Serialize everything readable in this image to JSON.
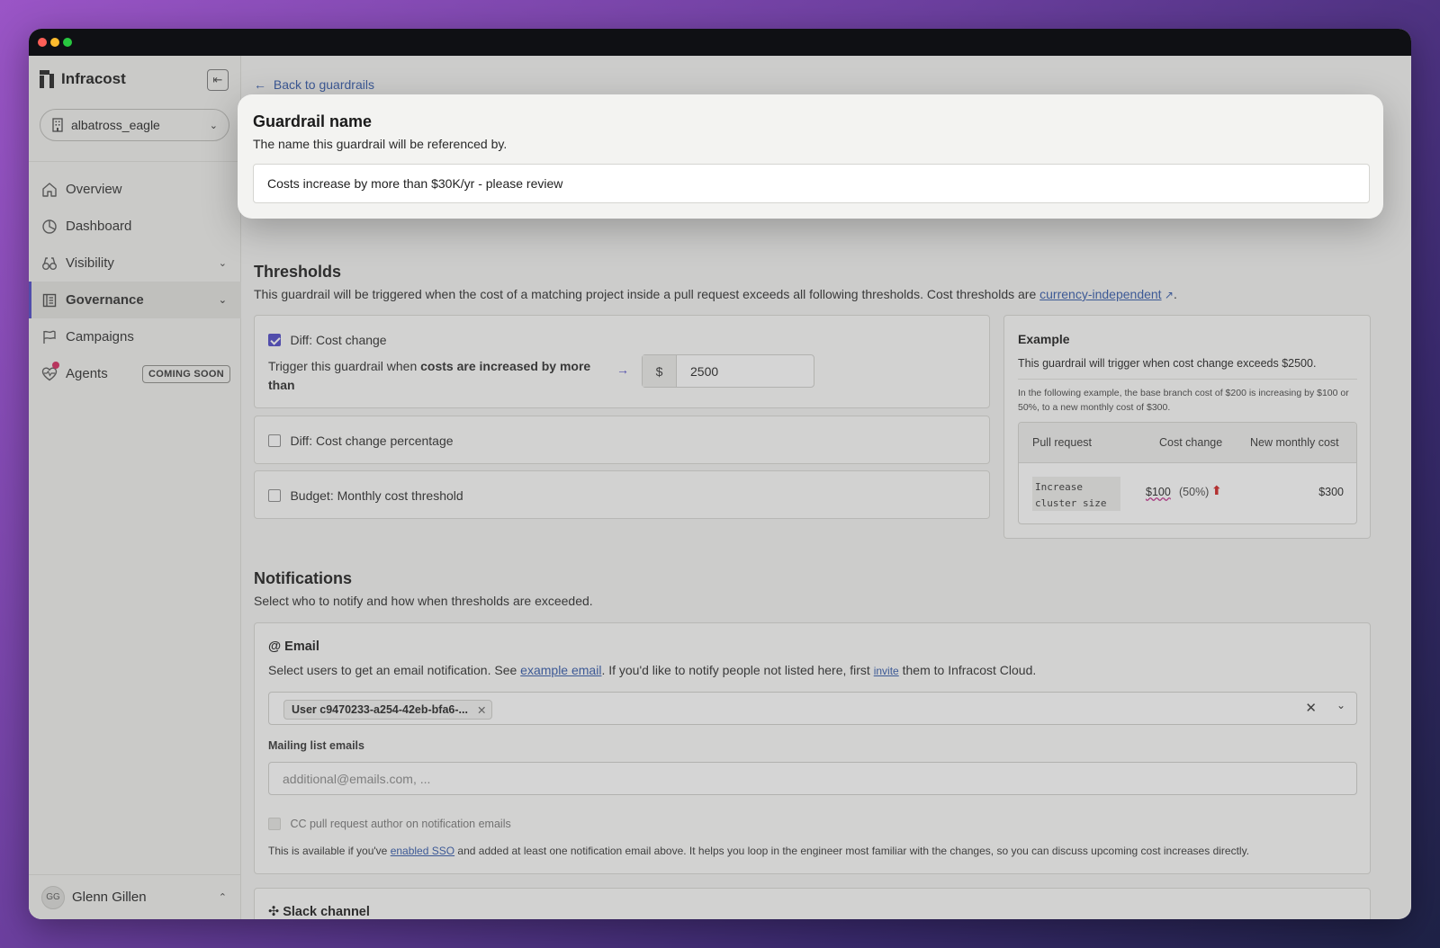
{
  "app": {
    "name": "Infracost"
  },
  "sidebar": {
    "org": "albatross_eagle",
    "items": [
      {
        "label": "Overview"
      },
      {
        "label": "Dashboard"
      },
      {
        "label": "Visibility"
      },
      {
        "label": "Governance"
      },
      {
        "label": "Campaigns"
      },
      {
        "label": "Agents",
        "badge": "COMING SOON"
      }
    ],
    "user": {
      "initials": "GG",
      "name": "Glenn Gillen"
    }
  },
  "main": {
    "back_link": "Back to guardrails",
    "thresholds": {
      "title": "Thresholds",
      "desc": "This guardrail will be triggered when the cost of a matching project inside a pull request exceeds all following thresholds. Cost thresholds are",
      "desc_link": "currency-independent",
      "cost_change": {
        "label": "Diff: Cost change",
        "trigger_prefix": "Trigger this guardrail when ",
        "trigger_bold_1": "costs are increased by more",
        "trigger_bold_2": "than",
        "currency": "$",
        "value": "2500"
      },
      "cost_change_pct": {
        "label": "Diff: Cost change percentage"
      },
      "budget": {
        "label": "Budget: Monthly cost threshold"
      }
    },
    "example": {
      "title": "Example",
      "summary": "This guardrail will trigger when cost change exceeds $2500.",
      "detail": "In the following example, the base branch cost of $200 is increasing by $100 or 50%, to a new monthly cost of $300.",
      "headers": [
        "Pull request",
        "Cost change",
        "New monthly cost"
      ],
      "row": {
        "pr_line1": "Increase",
        "pr_line2": "cluster size",
        "cost_change": "$100",
        "pct": "(50%)",
        "new_cost": "$300"
      }
    },
    "notifications": {
      "title": "Notifications",
      "desc": "Select who to notify and how when thresholds are exceeded.",
      "email": {
        "title": "Email",
        "desc_prefix": "Select users to get an email notification. See ",
        "desc_link1": "example email",
        "desc_mid": ". If you'd like to notify people not listed here, first ",
        "desc_link2": "invite",
        "desc_suffix": " them to Infracost Cloud.",
        "selected_user": "User c9470233-a254-42eb-bfa6-...",
        "mailing_label": "Mailing list emails",
        "mailing_placeholder": "additional@emails.com, ...",
        "cc_label": "CC pull request author on notification emails",
        "sso_prefix": "This is available if you've ",
        "sso_link": "enabled SSO",
        "sso_suffix": " and added at least one notification email above. It helps you loop in the engineer most familiar with the changes, so you can discuss upcoming cost increases directly."
      },
      "slack": {
        "title": "Slack channel"
      }
    }
  },
  "modal": {
    "title": "Guardrail name",
    "desc": "The name this guardrail will be referenced by.",
    "value": "Costs increase by more than $30K/yr - please review"
  }
}
